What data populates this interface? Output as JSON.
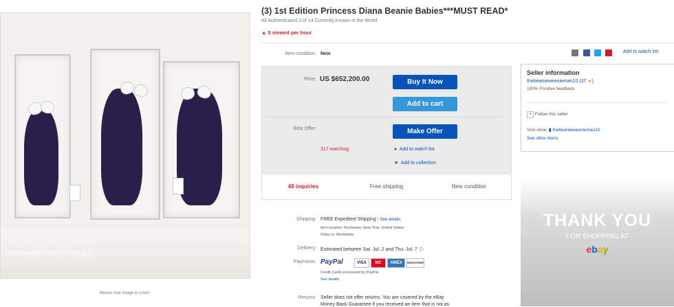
{
  "item": {
    "title": "(3) 1st Edition Princess Diana Beanie Babies***MUST READ*",
    "subtitle": "All Authenticated 2 of 14 Currently Known in the World",
    "viewed": "5 viewed per hour",
    "image_watermark": "thebeanieweenieman10",
    "zoom_hint": "Mouse over image to zoom"
  },
  "condition": {
    "label": "Item condition:",
    "value": "New"
  },
  "share": {
    "watch_link": "Add to watch list"
  },
  "buy": {
    "price_label": "Price:",
    "price": "US $652,200.00",
    "buy_now": "Buy It Now",
    "add_to_cart": "Add to cart",
    "best_offer_label": "Best Offer:",
    "make_offer": "Make Offer",
    "watching": "317 watching",
    "add_watch": "Add to watch list",
    "add_collection": "Add to collection"
  },
  "stats": {
    "inquiries": "48 inquiries",
    "shipping": "Free shipping",
    "condition": "New condition"
  },
  "shipping": {
    "label": "Shipping:",
    "value": "FREE  Expedited Shipping",
    "details": "See details",
    "location": "Item location:  Rochester, New York, United States",
    "ships_to": "Ships to:  Worldwide"
  },
  "delivery": {
    "label": "Delivery:",
    "value": "Estimated between Sat. Jul. 2 and Thu. Jul. 7"
  },
  "payments": {
    "label": "Payments:",
    "paypal": "PayPal",
    "credit_note": "Credit Cards processed by PayPal",
    "details": "See details",
    "cards": [
      "VISA",
      "MC",
      "AMEX",
      "DISCOVER"
    ]
  },
  "returns": {
    "label": "Returns:",
    "line1": "Seller does not offer returns. You are covered by the eBay",
    "line2": "Money Back Guarantee if you received an item that is not as"
  },
  "seller": {
    "heading": "Seller information",
    "name": "thebeanieweenieman10",
    "score": "(37",
    "feedback": "100% Positive feedback",
    "follow": "Follow this seller",
    "visit_label": "Visit store:",
    "store_name": "thebeanieweenieman10",
    "other_items": "See other items"
  },
  "ad": {
    "thank": "THANK YOU",
    "for_shopping": "FOR SHOPPING AT",
    "brand": "ebay"
  },
  "colors": {
    "accent": "#0654ba",
    "button_light": "#3498db",
    "alert": "#dd1e31"
  }
}
